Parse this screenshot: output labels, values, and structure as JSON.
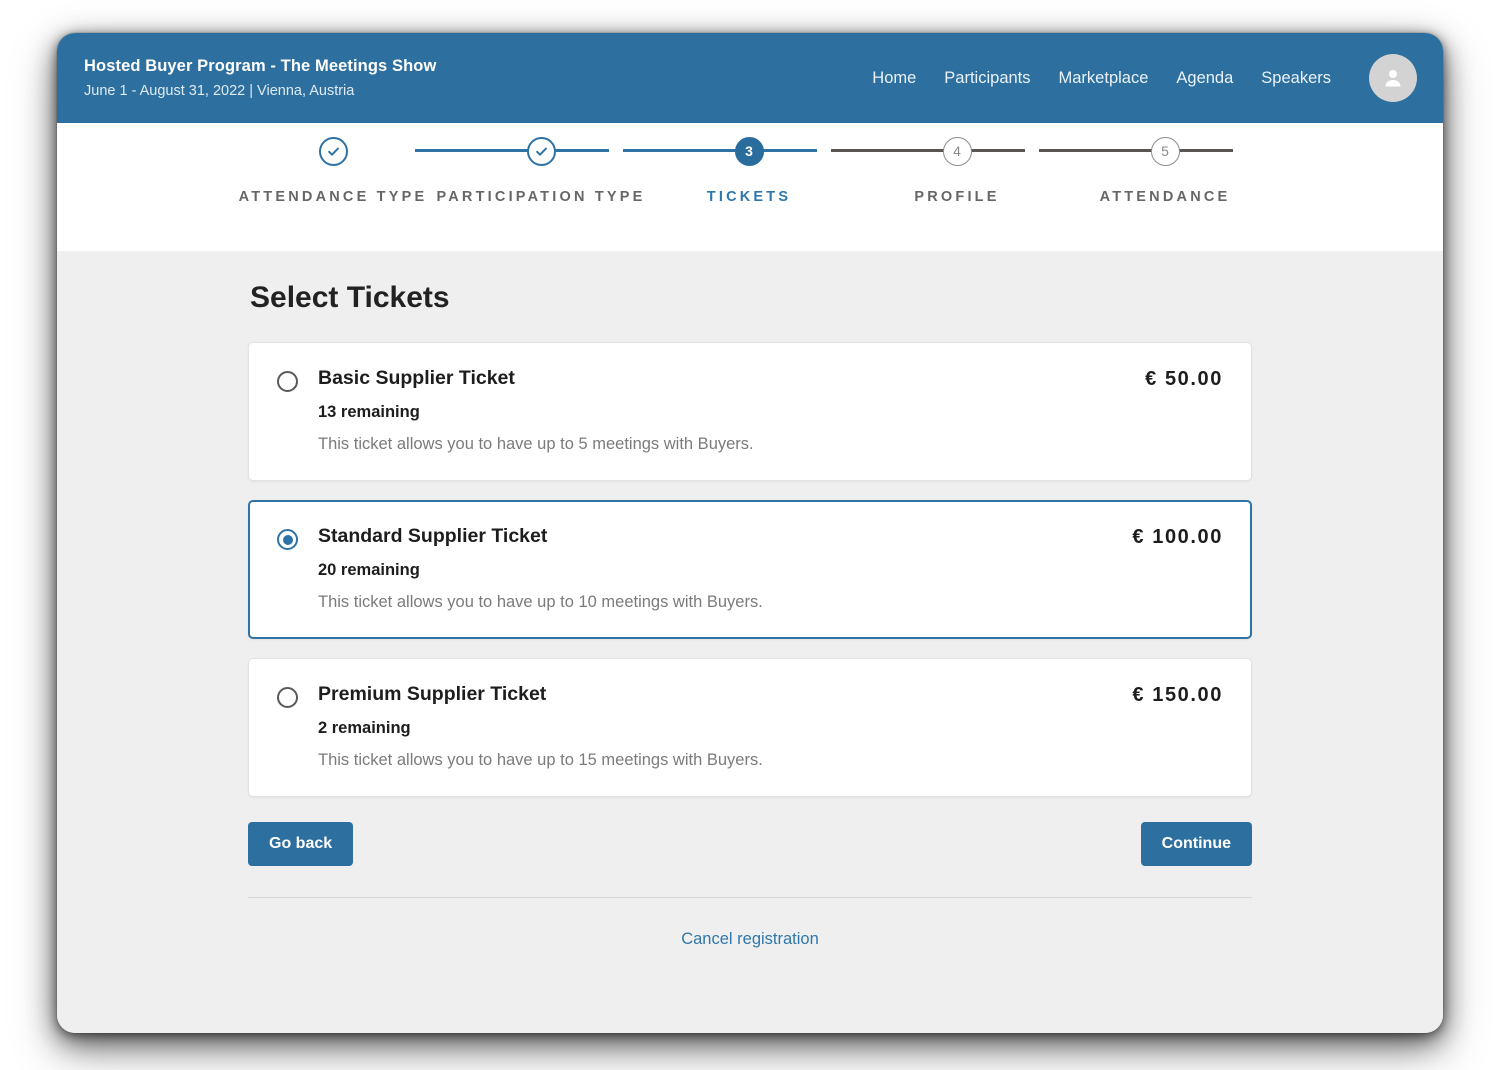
{
  "header": {
    "brand_title": "Hosted Buyer Program - The Meetings Show",
    "brand_subtitle": "June 1 - August 31, 2022 | Vienna, Austria",
    "nav": [
      {
        "label": "Home"
      },
      {
        "label": "Participants"
      },
      {
        "label": "Marketplace"
      },
      {
        "label": "Agenda"
      },
      {
        "label": "Speakers"
      }
    ],
    "avatar_icon": "user-avatar-icon",
    "bg_color": "#2d6f9e"
  },
  "stepper": {
    "active_index": 2,
    "steps": [
      {
        "label": "ATTENDANCE TYPE",
        "number": "1",
        "state": "done",
        "marker": "✓"
      },
      {
        "label": "PARTICIPATION TYPE",
        "number": "2",
        "state": "done",
        "marker": "✓"
      },
      {
        "label": "TICKETS",
        "number": "3",
        "state": "current",
        "marker": "3"
      },
      {
        "label": "PROFILE",
        "number": "4",
        "state": "todo",
        "marker": "4"
      },
      {
        "label": "ATTENDANCE",
        "number": "5",
        "state": "todo",
        "marker": "5"
      }
    ],
    "done_color": "#2f73a5",
    "todo_color": "#5a5550"
  },
  "main": {
    "title": "Select Tickets",
    "tickets": [
      {
        "name": "Basic Supplier Ticket",
        "remaining": "13 remaining",
        "description": "This ticket allows you to have up to 5 meetings with Buyers.",
        "price": "€ 50.00",
        "selected": false
      },
      {
        "name": "Standard Supplier Ticket",
        "remaining": "20 remaining",
        "description": "This ticket allows you to have up to 10 meetings with Buyers.",
        "price": "€ 100.00",
        "selected": true
      },
      {
        "name": "Premium Supplier Ticket",
        "remaining": "2 remaining",
        "description": "This ticket allows you to have up to 15 meetings with Buyers.",
        "price": "€ 150.00",
        "selected": false
      }
    ],
    "go_back_label": "Go back",
    "continue_label": "Continue",
    "cancel_label": "Cancel registration",
    "accent_color": "#2d6f9e",
    "link_color": "#2f77ab"
  }
}
